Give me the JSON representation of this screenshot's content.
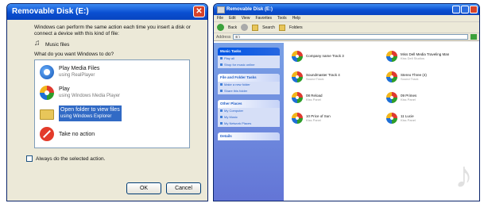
{
  "dialog": {
    "title": "Removable Disk (E:)",
    "close_glyph": "✕",
    "description": "Windows can perform the same action each time you insert a disk or connect a device with this kind of file:",
    "file_type": "Music files",
    "question": "What do you want Windows to do?",
    "actions": [
      {
        "label": "Play Media Files",
        "sub": "using RealPlayer",
        "icon": "realplayer-icon"
      },
      {
        "label": "Play",
        "sub": "using Windows Media Player",
        "icon": "windows-media-player-icon"
      },
      {
        "label": "Open folder to view files",
        "sub": "using Windows Explorer",
        "icon": "folder-icon",
        "selected": true
      },
      {
        "label": "Take no action",
        "sub": "",
        "icon": "no-action-icon"
      }
    ],
    "always_do_label": "Always do the selected action.",
    "ok_label": "OK",
    "cancel_label": "Cancel"
  },
  "explorer": {
    "title": "Removable Disk (E:)",
    "menu": [
      "File",
      "Edit",
      "View",
      "Favorites",
      "Tools",
      "Help"
    ],
    "toolbar": {
      "back_label": "Back",
      "search_label": "Search",
      "folders_label": "Folders"
    },
    "address_label": "Address",
    "address_value": "E:\\",
    "task_pane": [
      {
        "header": "Music Tasks",
        "items": [
          "Play all",
          "Shop for music online"
        ]
      },
      {
        "header": "File and Folder Tasks",
        "items": [
          "Make a new folder",
          "Share this folder"
        ]
      },
      {
        "header": "Other Places",
        "items": [
          "My Computer",
          "My Music",
          "My Network Places"
        ]
      },
      {
        "header": "Details",
        "items": []
      }
    ],
    "tracks": [
      {
        "name": "Company name Track 3",
        "sub": ""
      },
      {
        "name": "Miss Dell Media Traveling Man",
        "sub": "Kiss Dell Studios"
      },
      {
        "name": "Soundmaster Track 4",
        "sub": "Sound Track"
      },
      {
        "name": "Stereo Three (4)",
        "sub": "Sound Track"
      },
      {
        "name": "08 Reload",
        "sub": "Kiss Panel"
      },
      {
        "name": "09 Primes",
        "sub": "Kiss Panel"
      },
      {
        "name": "10 Price of Sun",
        "sub": "Kiss Panel"
      },
      {
        "name": "11 Lucie",
        "sub": "Kiss Panel"
      }
    ]
  }
}
